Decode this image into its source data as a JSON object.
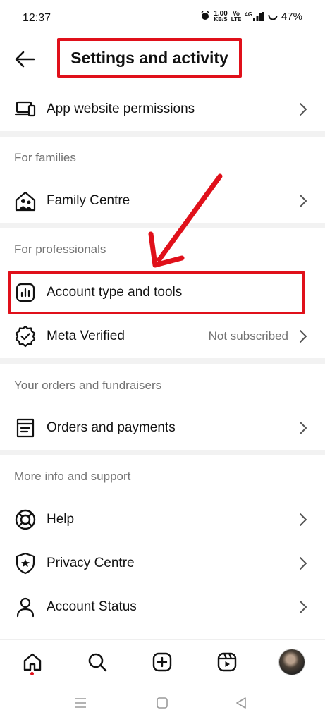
{
  "status_bar": {
    "time": "12:37",
    "speed_top": "1.00",
    "speed_unit": "KB/S",
    "volte_top": "Vo",
    "volte_bottom": "LTE",
    "network": "4G",
    "battery": "47%"
  },
  "header": {
    "title": "Settings and activity",
    "back_icon": "arrow-left-icon"
  },
  "sections": {
    "top_row": {
      "label": "App website permissions",
      "icon": "devices-icon"
    },
    "for_families": {
      "title": "For families",
      "items": [
        {
          "label": "Family Centre",
          "icon": "family-icon"
        }
      ]
    },
    "for_professionals": {
      "title": "For professionals",
      "items": [
        {
          "label": "Account type and tools",
          "icon": "bar-chart-icon"
        },
        {
          "label": "Meta Verified",
          "value": "Not subscribed",
          "icon": "verified-badge-icon"
        }
      ]
    },
    "orders": {
      "title": "Your orders and fundraisers",
      "items": [
        {
          "label": "Orders and payments",
          "icon": "receipt-icon"
        }
      ]
    },
    "support": {
      "title": "More info and support",
      "items": [
        {
          "label": "Help",
          "icon": "lifebuoy-icon"
        },
        {
          "label": "Privacy Centre",
          "icon": "shield-icon"
        },
        {
          "label": "Account Status",
          "icon": "person-icon"
        }
      ]
    }
  },
  "bottom_nav": [
    "home-icon",
    "search-icon",
    "create-icon",
    "reels-icon",
    "profile-avatar"
  ],
  "annotation_color": "#e0101a"
}
